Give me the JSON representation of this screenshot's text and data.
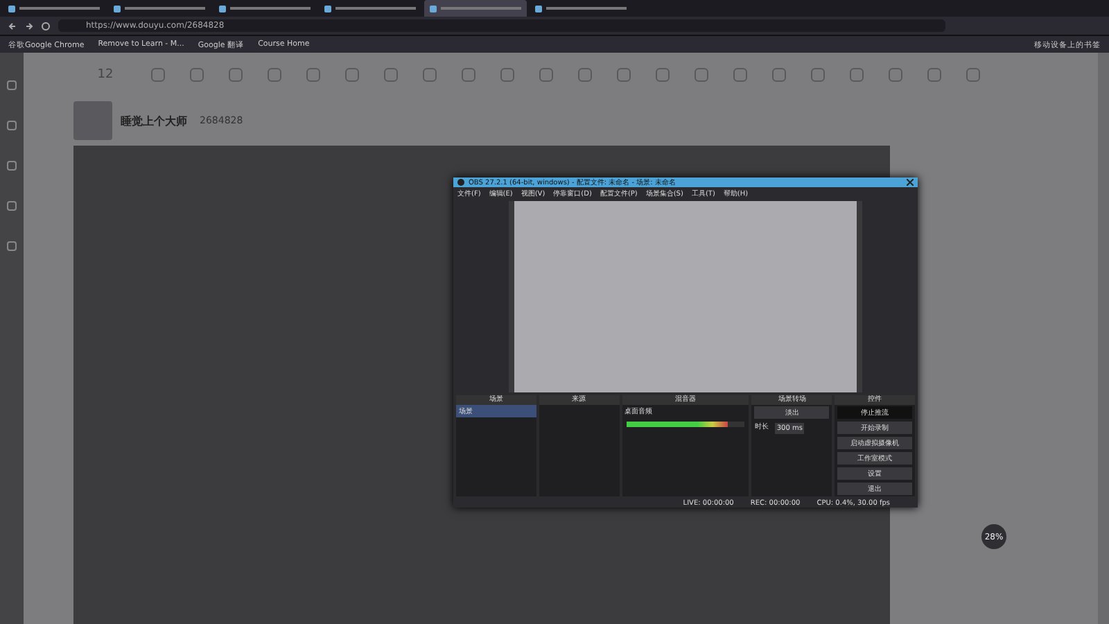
{
  "browser": {
    "tabs": [
      {
        "selected": false
      },
      {
        "selected": false
      },
      {
        "selected": false
      },
      {
        "selected": false
      },
      {
        "selected": true
      },
      {
        "selected": false
      }
    ],
    "url": "https://www.douyu.com/2684828",
    "bookmarks": [
      {
        "label": "谷歌Google Chrome"
      },
      {
        "label": "Remove to Learn - M..."
      },
      {
        "label": "Google 翻译"
      },
      {
        "label": "Course Home"
      },
      {
        "label": "移动设备上的书签"
      }
    ]
  },
  "page": {
    "follow_count": "12",
    "streamer": {
      "name": "睡觉上个大师",
      "room": "2684828"
    },
    "float_widget": {
      "percent": "28%"
    }
  },
  "obs": {
    "title": "OBS 27.2.1 (64-bit, windows) - 配置文件: 未命名 - 场景: 未命名",
    "menu": [
      "文件(F)",
      "编辑(E)",
      "视图(V)",
      "停靠窗口(D)",
      "配置文件(P)",
      "场景集合(S)",
      "工具(T)",
      "帮助(H)"
    ],
    "docks": {
      "scenes": {
        "title": "场景",
        "items": [
          {
            "label": "场景",
            "selected": true
          }
        ]
      },
      "sources": {
        "title": "来源"
      },
      "mixer": {
        "title": "混音器",
        "channel": "桌面音频",
        "level": 0.85
      },
      "transitions": {
        "title": "场景转场",
        "type": "淡出",
        "duration_label": "时长",
        "duration": "300 ms"
      },
      "controls": {
        "title": "控件",
        "buttons": [
          {
            "label": "停止推流",
            "active": true
          },
          {
            "label": "开始录制",
            "active": false
          },
          {
            "label": "启动虚拟摄像机",
            "active": false
          },
          {
            "label": "工作室模式",
            "active": false
          },
          {
            "label": "设置",
            "active": false
          },
          {
            "label": "退出",
            "active": false
          }
        ]
      }
    },
    "status": {
      "live": "LIVE: 00:00:00",
      "rec": "REC: 00:00:00",
      "cpu": "CPU: 0.4%, 30.00 fps"
    }
  }
}
